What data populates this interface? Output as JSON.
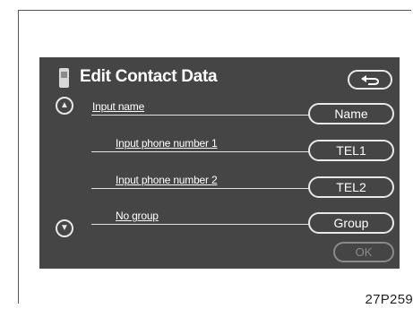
{
  "header": {
    "title": "Edit Contact Data"
  },
  "rows": [
    {
      "label": "Input name",
      "button": "Name"
    },
    {
      "label": "Input phone number 1",
      "button": "TEL1"
    },
    {
      "label": "Input phone number 2",
      "button": "TEL2"
    },
    {
      "label": "No group",
      "button": "Group"
    }
  ],
  "footer": {
    "ok_label": "OK"
  },
  "caption": "27P259",
  "icons": {
    "phone": "phone-icon",
    "back": "back-arrow-icon",
    "scroll_up": "double-chevron-up-icon",
    "scroll_down": "double-chevron-down-icon"
  },
  "colors": {
    "screen_bg": "#454545",
    "text": "#ffffff",
    "disabled": "#8a8a8a"
  }
}
